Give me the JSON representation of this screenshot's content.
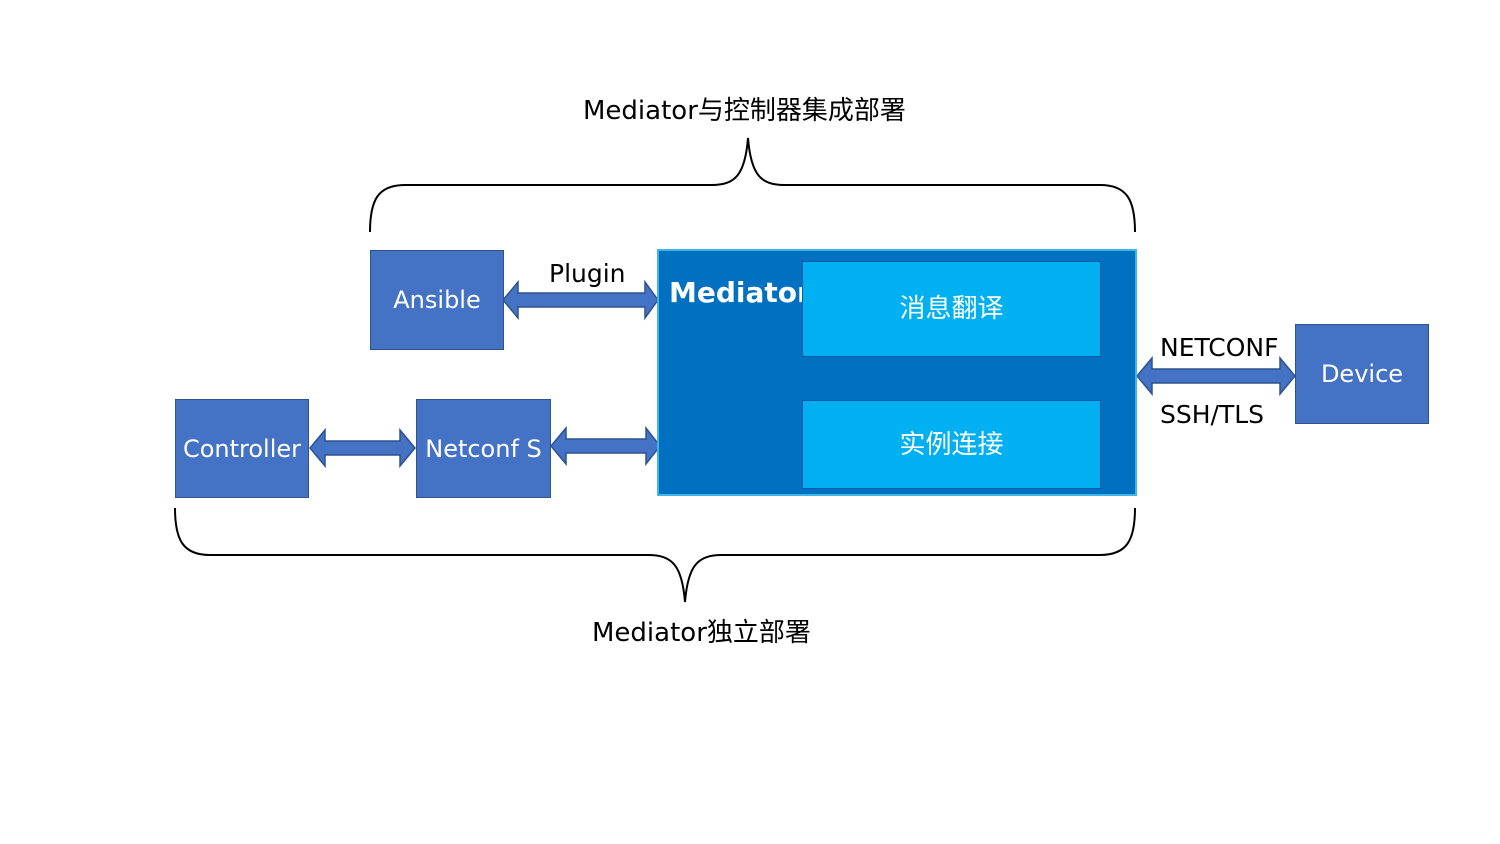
{
  "diagram": {
    "top_caption": "Mediator与控制器集成部署",
    "bottom_caption": "Mediator独立部署",
    "nodes": {
      "ansible": "Ansible",
      "controller": "Controller",
      "netconf_s": "Netconf S",
      "mediator": "Mediator",
      "message_translation": "消息翻译",
      "instance_connection": "实例连接",
      "device": "Device"
    },
    "edge_labels": {
      "plugin": "Plugin",
      "netconf": "NETCONF",
      "ssh_tls": "SSH/TLS"
    },
    "edges": [
      {
        "from": "ansible",
        "to": "mediator",
        "label": "Plugin",
        "direction": "both"
      },
      {
        "from": "controller",
        "to": "netconf_s",
        "direction": "both"
      },
      {
        "from": "netconf_s",
        "to": "mediator",
        "direction": "both"
      },
      {
        "from": "mediator",
        "to": "device",
        "label": "NETCONF / SSH/TLS",
        "direction": "both"
      }
    ],
    "colors": {
      "node_fill": "#4472c4",
      "mediator_fill": "#0070c0",
      "sub_box_fill": "#00b0f0",
      "text_on_fill": "#ffffff"
    }
  }
}
